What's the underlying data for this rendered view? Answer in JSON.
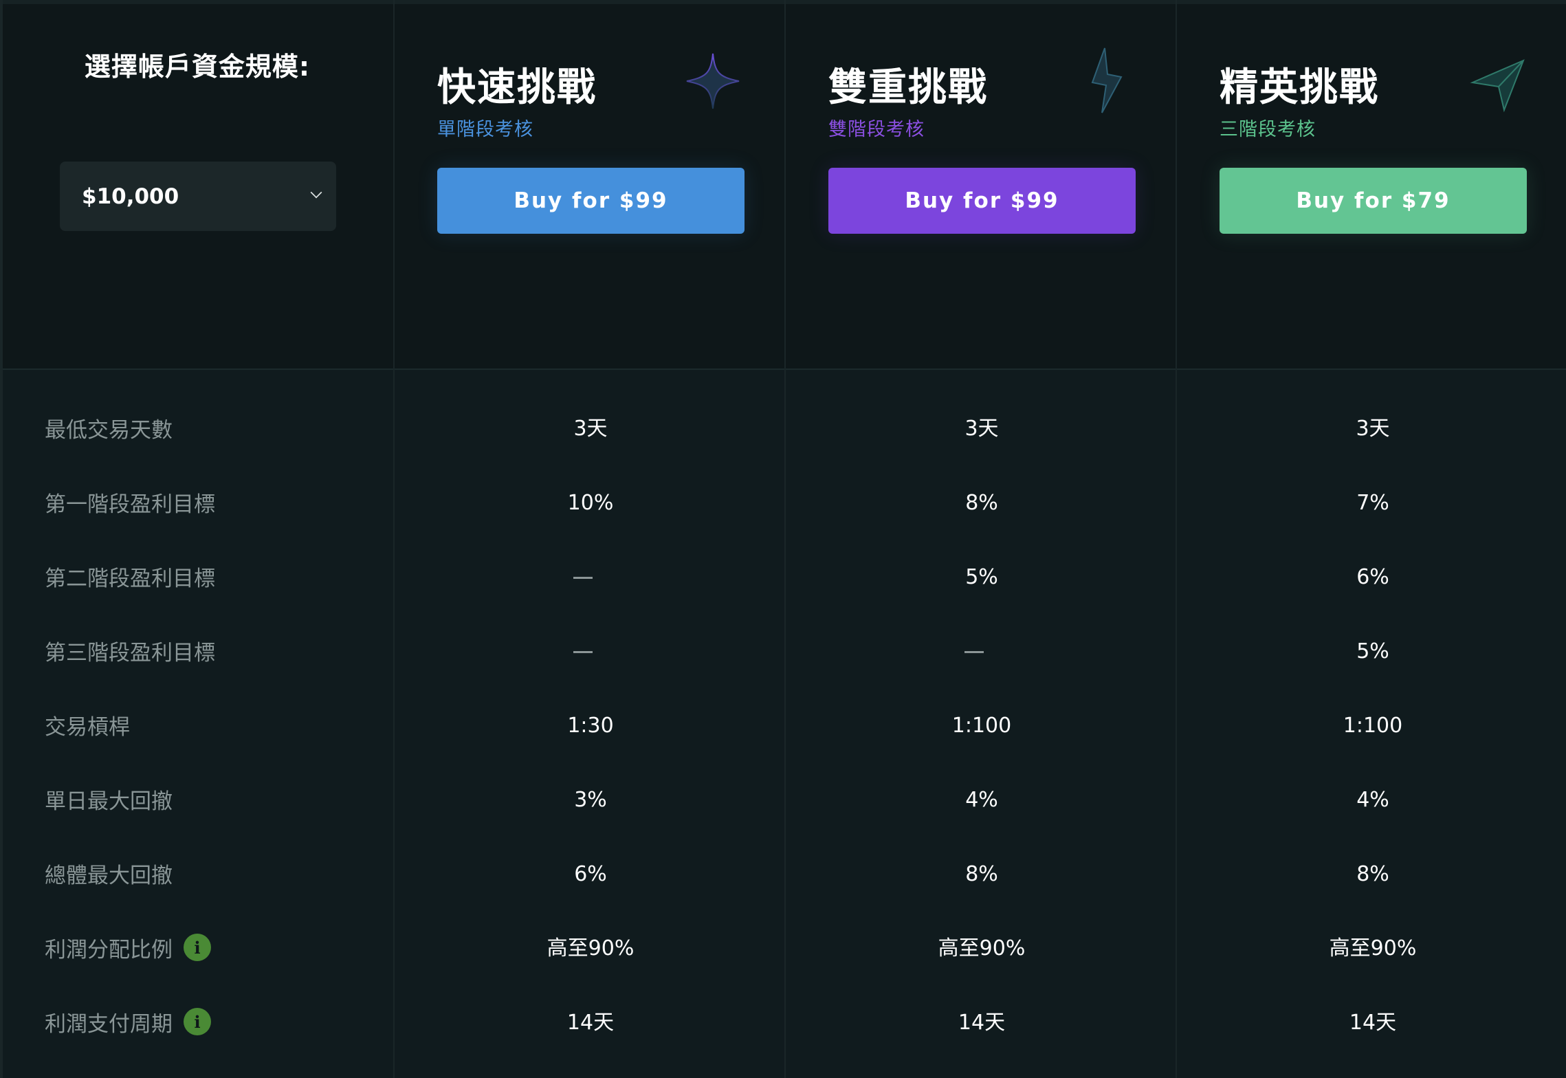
{
  "selector": {
    "title": "選擇帳戶資金規模:",
    "value": "$10,000"
  },
  "plans": [
    {
      "title": "快速挑戰",
      "subtitle": "單階段考核",
      "subtitle_color": "#4a92de",
      "button_label": "Buy for $99",
      "button_color": "#4590dc",
      "icon": "four-point-star-icon",
      "values": [
        "3天",
        "10%",
        "—",
        "—",
        "1:30",
        "3%",
        "6%",
        "高至90%",
        "14天"
      ]
    },
    {
      "title": "雙重挑戰",
      "subtitle": "雙階段考核",
      "subtitle_color": "#8a4fe0",
      "button_label": "Buy for $99",
      "button_color": "#7c45dd",
      "icon": "lightning-icon",
      "values": [
        "3天",
        "8%",
        "5%",
        "—",
        "1:100",
        "4%",
        "8%",
        "高至90%",
        "14天"
      ]
    },
    {
      "title": "精英挑戰",
      "subtitle": "三階段考核",
      "subtitle_color": "#5cc38d",
      "button_label": "Buy for $79",
      "button_color": "#63c593",
      "icon": "paper-plane-icon",
      "values": [
        "3天",
        "7%",
        "6%",
        "5%",
        "1:100",
        "4%",
        "8%",
        "高至90%",
        "14天"
      ]
    }
  ],
  "rows": [
    {
      "label": "最低交易天數",
      "info": false
    },
    {
      "label": "第一階段盈利目標",
      "info": false
    },
    {
      "label": "第二階段盈利目標",
      "info": false
    },
    {
      "label": "第三階段盈利目標",
      "info": false
    },
    {
      "label": "交易槓桿",
      "info": false
    },
    {
      "label": "單日最大回撤",
      "info": false
    },
    {
      "label": "總體最大回撤",
      "info": false
    },
    {
      "label": "利潤分配比例",
      "info": true
    },
    {
      "label": "利潤支付周期",
      "info": true
    }
  ],
  "info_icon_glyph": "i"
}
